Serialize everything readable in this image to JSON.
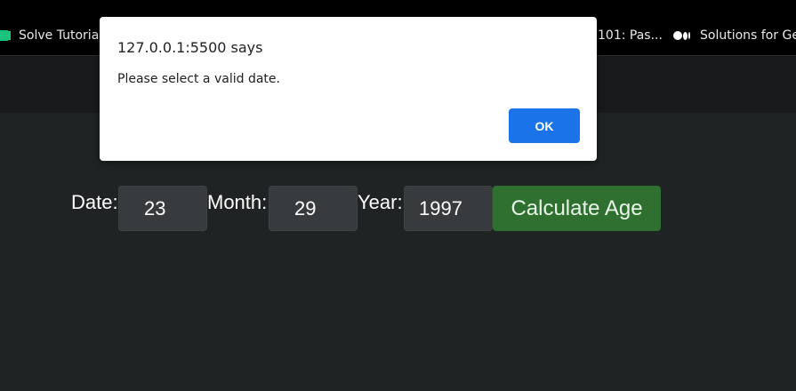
{
  "bookmarks": {
    "items": [
      {
        "label": "Solve Tutorials",
        "icon": "green-bar-icon"
      },
      {
        "label": "101: Pas...",
        "icon": ""
      },
      {
        "label": "Solutions for Gee",
        "icon": "medium-logo-icon"
      }
    ]
  },
  "form": {
    "date_label": "Date:",
    "date_value": "23",
    "month_label": "Month:",
    "month_value": "29",
    "year_label": "Year:",
    "year_value": "1997",
    "calculate_label": "Calculate Age"
  },
  "dialog": {
    "title": "127.0.0.1:5500 says",
    "message": "Please select a valid date.",
    "ok_label": "OK"
  },
  "colors": {
    "page_bg": "#1f2324",
    "navbar_bg": "#181a1b",
    "button_green": "#2f7030",
    "dialog_button_blue": "#1a73e8"
  }
}
